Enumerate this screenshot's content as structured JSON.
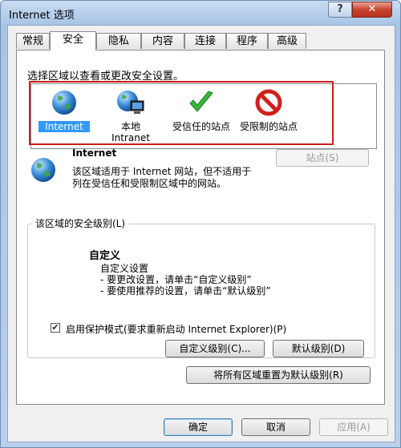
{
  "window": {
    "title": "Internet 选项",
    "help": "?",
    "close": "✕"
  },
  "tabs": [
    {
      "label": "常规"
    },
    {
      "label": "安全"
    },
    {
      "label": "隐私"
    },
    {
      "label": "内容"
    },
    {
      "label": "连接"
    },
    {
      "label": "程序"
    },
    {
      "label": "高级"
    }
  ],
  "security": {
    "zone_prompt": "选择区域以查看或更改安全设置。",
    "zones": [
      {
        "label": "Internet"
      },
      {
        "label": "本地\nIntranet"
      },
      {
        "label": "受信任的站点"
      },
      {
        "label": "受限制的站点"
      }
    ],
    "sites_button": "站点(S)",
    "selected_zone": {
      "name": "Internet",
      "description": "该区域适用于 Internet 网站，但不适用于列在受信任和受限制区域中的网站。"
    },
    "level_group": {
      "label": "该区域的安全级别(L)",
      "level_name": "自定义",
      "desc_line1": "自定义设置",
      "desc_line2": "- 要更改设置，请单击“自定义级别”",
      "desc_line3": "- 要使用推荐的设置，请单击“默认级别”",
      "protected_mode_label": "启用保护模式(要求重新启动 Internet Explorer)(P)",
      "protected_mode_checked": true,
      "custom_level_button": "自定义级别(C)...",
      "default_level_button": "默认级别(D)"
    },
    "reset_all_button": "将所有区域重置为默认级别(R)"
  },
  "footer": {
    "ok": "确定",
    "cancel": "取消",
    "apply": "应用(A)"
  },
  "colors": {
    "selection": "#3399ff",
    "highlight_box": "#d11a1a",
    "check_green": "#3cb43c",
    "restricted_red": "#d0201c"
  }
}
